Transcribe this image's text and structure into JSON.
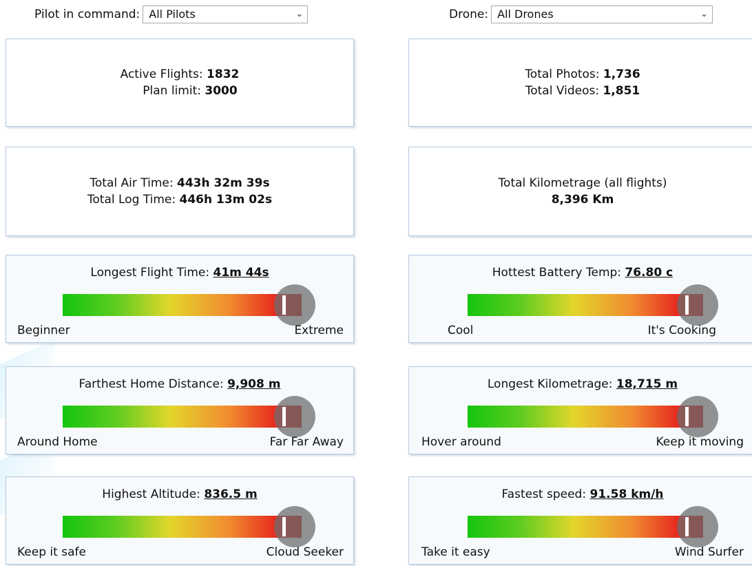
{
  "filters": {
    "pilot_label": "Pilot in command:",
    "pilot_value": "All Pilots",
    "drone_label": "Drone:",
    "drone_value": "All Drones"
  },
  "stats": {
    "active_flights_label": "Active Flights:",
    "active_flights_value": "1832",
    "plan_limit_label": "Plan limit:",
    "plan_limit_value": "3000",
    "total_photos_label": "Total Photos:",
    "total_photos_value": "1,736",
    "total_videos_label": "Total Videos:",
    "total_videos_value": "1,851",
    "air_time_label": "Total Air Time:",
    "air_time_value": "443h 32m 39s",
    "log_time_label": "Total Log Time:",
    "log_time_value": "446h 13m 02s",
    "kilometrage_label": "Total Kilometrage (all flights)",
    "kilometrage_value": "8,396 Km"
  },
  "gauges": {
    "longest_flight": {
      "title": "Longest Flight Time:",
      "value": "41m 44s",
      "low": "Beginner",
      "high": "Extreme",
      "level": 1.0
    },
    "hottest_battery": {
      "title": "Hottest Battery Temp:",
      "value": "76.80 c",
      "low": "Cool",
      "high": "It's Cooking",
      "level": 1.0
    },
    "farthest_home": {
      "title": "Farthest Home Distance:",
      "value": "9,908 m",
      "low": "Around Home",
      "high": "Far Far Away",
      "level": 1.0
    },
    "longest_km": {
      "title": "Longest Kilometrage:",
      "value": "18,715 m",
      "low": "Hover around",
      "high": "Keep it moving",
      "level": 1.0
    },
    "highest_altitude": {
      "title": "Highest Altitude:",
      "value": "836.5 m",
      "low": "Keep it safe",
      "high": "Cloud Seeker",
      "level": 1.0
    },
    "fastest_speed": {
      "title": "Fastest speed:",
      "value": "91.58 km/h",
      "low": "Take it easy",
      "high": "Wind Surfer",
      "level": 1.0
    }
  },
  "colors": {
    "bar_start": "#14c50f",
    "bar_mid": "#e3d62c",
    "bar_end": "#c41010",
    "card_border": "#b5c8dc"
  },
  "icons": {
    "select_arrow": "chevron-down-icon"
  }
}
